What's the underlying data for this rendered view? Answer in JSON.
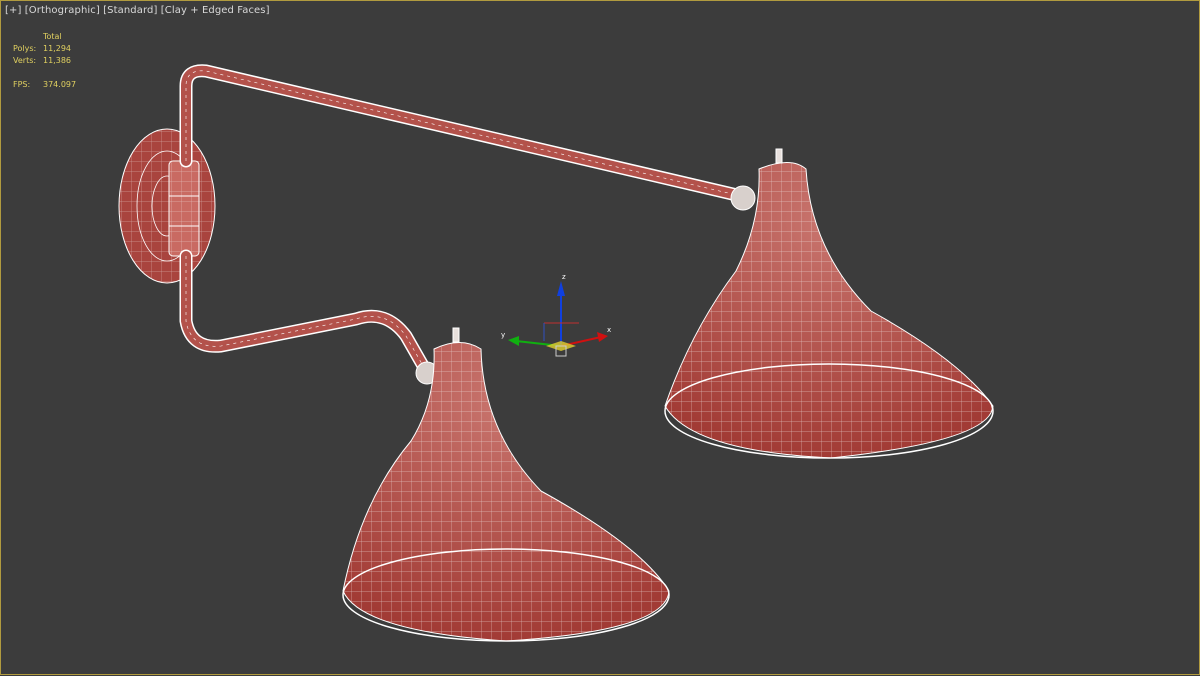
{
  "viewport": {
    "menu_plus": "[+]",
    "view_label": "[Orthographic]",
    "shading_label": "[Standard]",
    "style_label": "[Clay + Edged Faces]"
  },
  "stats": {
    "total_label": "Total",
    "polys_label": "Polys:",
    "polys_value": "11,294",
    "verts_label": "Verts:",
    "verts_value": "11,386",
    "fps_label": "FPS:",
    "fps_value": "374.097"
  },
  "gizmo": {
    "x_label": "x",
    "y_label": "y",
    "z_label": "z",
    "x_color": "#d01010",
    "y_color": "#10b010",
    "z_color": "#1040e0"
  },
  "colors": {
    "background": "#3c3c3c",
    "clay": "#a9443e",
    "wire": "#ffffff",
    "border": "#b19b3f",
    "stats_text": "#e0d060"
  }
}
